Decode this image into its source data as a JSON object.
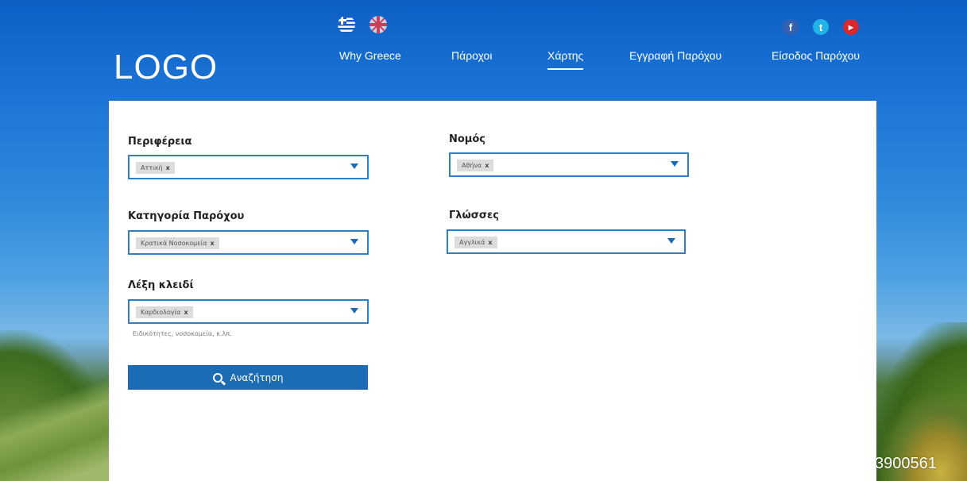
{
  "header": {
    "logo": "LOGO",
    "languages": [
      {
        "name": "greek-flag-icon"
      },
      {
        "name": "uk-flag-icon"
      }
    ],
    "social": {
      "facebook": "f",
      "twitter": "t",
      "youtube": "You Tube"
    },
    "nav": [
      {
        "label": "Why Greece",
        "active": false
      },
      {
        "label": "Πάροχοι",
        "active": false
      },
      {
        "label": "Χάρτης",
        "active": true
      },
      {
        "label": "Εγγραφή Παρόχου",
        "active": false
      },
      {
        "label": "Είσοδος Παρόχου",
        "active": false
      }
    ]
  },
  "form": {
    "region": {
      "label": "Περιφέρεια",
      "chip": "Αττική"
    },
    "prefecture": {
      "label": "Νομός",
      "chip": "Αθήνα"
    },
    "category": {
      "label": "Κατηγορία Παρόχου",
      "chip": "Κρατικά Νοσοκομεία"
    },
    "languages": {
      "label": "Γλώσσες",
      "chip": "Αγγλικά"
    },
    "keyword": {
      "label": "Λέξη κλειδί",
      "chip": "Καρδιολογία",
      "hint": "Ειδικότητες, νοσοκομεία, κ.λπ."
    },
    "chip_remove": "x",
    "search_label": "Αναζήτηση"
  },
  "watermark": "3900561",
  "colors": {
    "accent": "#1b6cb5",
    "border": "#2d80c3",
    "chip_bg": "#dcdcdc"
  }
}
